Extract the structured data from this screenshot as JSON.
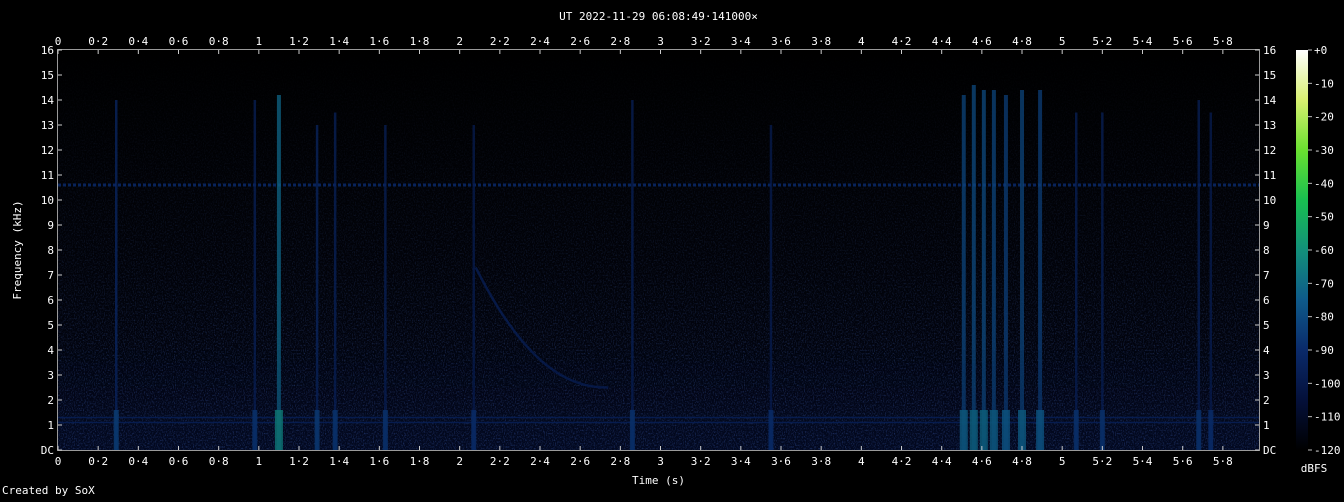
{
  "chart_data": {
    "type": "heatmap",
    "title": "UT 2022-11-29 06:08:49·141000×",
    "xlabel": "Time (s)",
    "ylabel": "Frequency (kHz)",
    "xlim": [
      0,
      5.98
    ],
    "ylim": [
      0,
      16
    ],
    "grid": false,
    "x_ticks": [
      {
        "v": 0,
        "label": "0"
      },
      {
        "v": 0.2,
        "label": "0·2"
      },
      {
        "v": 0.4,
        "label": "0·4"
      },
      {
        "v": 0.6,
        "label": "0·6"
      },
      {
        "v": 0.8,
        "label": "0·8"
      },
      {
        "v": 1,
        "label": "1"
      },
      {
        "v": 1.2,
        "label": "1·2"
      },
      {
        "v": 1.4,
        "label": "1·4"
      },
      {
        "v": 1.6,
        "label": "1·6"
      },
      {
        "v": 1.8,
        "label": "1·8"
      },
      {
        "v": 2,
        "label": "2"
      },
      {
        "v": 2.2,
        "label": "2·2"
      },
      {
        "v": 2.4,
        "label": "2·4"
      },
      {
        "v": 2.6,
        "label": "2·6"
      },
      {
        "v": 2.8,
        "label": "2·8"
      },
      {
        "v": 3,
        "label": "3"
      },
      {
        "v": 3.2,
        "label": "3·2"
      },
      {
        "v": 3.4,
        "label": "3·4"
      },
      {
        "v": 3.6,
        "label": "3·6"
      },
      {
        "v": 3.8,
        "label": "3·8"
      },
      {
        "v": 4,
        "label": "4"
      },
      {
        "v": 4.2,
        "label": "4·2"
      },
      {
        "v": 4.4,
        "label": "4·4"
      },
      {
        "v": 4.6,
        "label": "4·6"
      },
      {
        "v": 4.8,
        "label": "4·8"
      },
      {
        "v": 5,
        "label": "5"
      },
      {
        "v": 5.2,
        "label": "5·2"
      },
      {
        "v": 5.4,
        "label": "5·4"
      },
      {
        "v": 5.6,
        "label": "5·6"
      },
      {
        "v": 5.8,
        "label": "5·8"
      }
    ],
    "y_ticks": [
      {
        "v": 0,
        "label": "DC"
      },
      {
        "v": 1,
        "label": "1"
      },
      {
        "v": 2,
        "label": "2"
      },
      {
        "v": 3,
        "label": "3"
      },
      {
        "v": 4,
        "label": "4"
      },
      {
        "v": 5,
        "label": "5"
      },
      {
        "v": 6,
        "label": "6"
      },
      {
        "v": 7,
        "label": "7"
      },
      {
        "v": 8,
        "label": "8"
      },
      {
        "v": 9,
        "label": "9"
      },
      {
        "v": 10,
        "label": "10"
      },
      {
        "v": 11,
        "label": "11"
      },
      {
        "v": 12,
        "label": "12"
      },
      {
        "v": 13,
        "label": "13"
      },
      {
        "v": 14,
        "label": "14"
      },
      {
        "v": 15,
        "label": "15"
      },
      {
        "v": 16,
        "label": "16"
      }
    ],
    "colorbar": {
      "label": "dBFS",
      "range": [
        -120,
        0
      ],
      "ticks": [
        {
          "v": 0,
          "label": "+0"
        },
        {
          "v": -10,
          "label": "-10"
        },
        {
          "v": -20,
          "label": "-20"
        },
        {
          "v": -30,
          "label": "-30"
        },
        {
          "v": -40,
          "label": "-40"
        },
        {
          "v": -50,
          "label": "-50"
        },
        {
          "v": -60,
          "label": "-60"
        },
        {
          "v": -70,
          "label": "-70"
        },
        {
          "v": -80,
          "label": "-80"
        },
        {
          "v": -90,
          "label": "-90"
        },
        {
          "v": -100,
          "label": "-100"
        },
        {
          "v": -110,
          "label": "-110"
        },
        {
          "v": -120,
          "label": "-120"
        }
      ],
      "colors": [
        "#000000",
        "#04103a",
        "#0a2a6a",
        "#0e5a8a",
        "#12907a",
        "#18c050",
        "#6ae030",
        "#d8f070",
        "#ffffff"
      ]
    },
    "features": {
      "background_level_dbfs": -110,
      "hum_lines_khz": [
        10.6,
        1.3,
        1.1
      ],
      "vertical_bursts": [
        {
          "t": 0.29,
          "f_top": 14.0,
          "level": -92
        },
        {
          "t": 0.98,
          "f_top": 14.0,
          "level": -96
        },
        {
          "t": 1.1,
          "f_top": 14.2,
          "level": -72
        },
        {
          "t": 1.29,
          "f_top": 13.0,
          "level": -93
        },
        {
          "t": 1.38,
          "f_top": 13.5,
          "level": -95
        },
        {
          "t": 1.63,
          "f_top": 13.0,
          "level": -96
        },
        {
          "t": 2.07,
          "f_top": 13.0,
          "level": -98
        },
        {
          "t": 2.86,
          "f_top": 14.0,
          "level": -96
        },
        {
          "t": 3.55,
          "f_top": 13.0,
          "level": -98
        },
        {
          "t": 4.51,
          "f_top": 14.2,
          "level": -82
        },
        {
          "t": 4.56,
          "f_top": 14.6,
          "level": -80
        },
        {
          "t": 4.61,
          "f_top": 14.4,
          "level": -80
        },
        {
          "t": 4.66,
          "f_top": 14.4,
          "level": -82
        },
        {
          "t": 4.72,
          "f_top": 14.2,
          "level": -84
        },
        {
          "t": 4.8,
          "f_top": 14.4,
          "level": -82
        },
        {
          "t": 4.89,
          "f_top": 14.4,
          "level": -84
        },
        {
          "t": 5.07,
          "f_top": 13.5,
          "level": -96
        },
        {
          "t": 5.2,
          "f_top": 13.5,
          "level": -96
        },
        {
          "t": 5.68,
          "f_top": 14.0,
          "level": -96
        },
        {
          "t": 5.74,
          "f_top": 13.5,
          "level": -98
        }
      ],
      "whistler": {
        "t_start": 2.08,
        "f_start": 7.3,
        "t_end": 2.74,
        "f_end": 2.5
      }
    }
  },
  "footer": {
    "credit": "Created by SoX"
  }
}
